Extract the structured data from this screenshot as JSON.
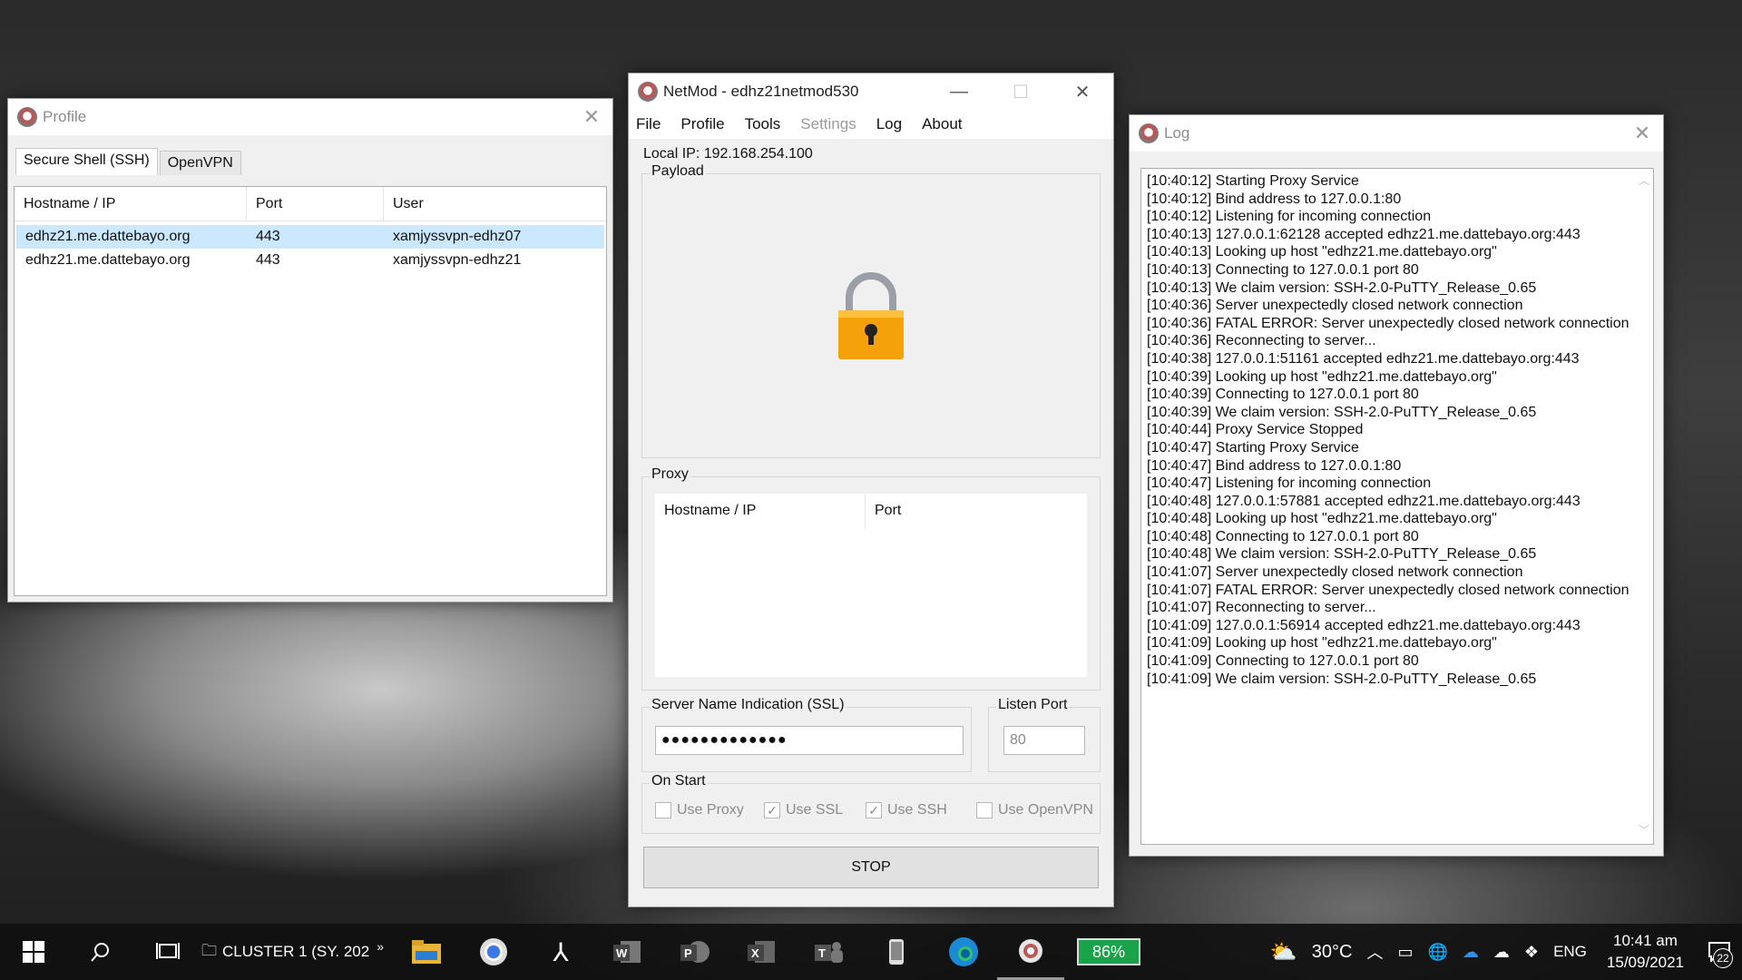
{
  "profile": {
    "title": "Profile",
    "tabs": [
      "Secure Shell (SSH)",
      "OpenVPN"
    ],
    "columns": [
      "Hostname / IP",
      "Port",
      "User"
    ],
    "rows": [
      [
        "edhz21.me.dattebayo.org",
        "443",
        "xamjyssvpn-edhz07"
      ],
      [
        "edhz21.me.dattebayo.org",
        "443",
        "xamjyssvpn-edhz21"
      ]
    ]
  },
  "netmod": {
    "title": "NetMod - edhz21netmod530",
    "menu": [
      "File",
      "Profile",
      "Tools",
      "Settings",
      "Log",
      "About"
    ],
    "local_ip": "Local IP: 192.168.254.100",
    "payload_label": "Payload",
    "proxy_label": "Proxy",
    "proxy_columns": [
      "Hostname / IP",
      "Port"
    ],
    "sni_label": "Server Name Indication (SSL)",
    "sni_value": "●●●●●●●●●●●●●",
    "listen_port_label": "Listen Port",
    "listen_port_value": "80",
    "on_start_label": "On Start",
    "checks": [
      {
        "label": "Use Proxy",
        "checked": false
      },
      {
        "label": "Use SSL",
        "checked": true
      },
      {
        "label": "Use SSH",
        "checked": true
      },
      {
        "label": "Use OpenVPN",
        "checked": false
      }
    ],
    "stop_label": "STOP"
  },
  "log": {
    "title": "Log",
    "lines": [
      "[10:40:12] Starting Proxy Service",
      "[10:40:12] Bind address to 127.0.0.1:80",
      "[10:40:12] Listening for incoming connection",
      "[10:40:13] 127.0.0.1:62128 accepted edhz21.me.dattebayo.org:443",
      "[10:40:13] Looking up host \"edhz21.me.dattebayo.org\"",
      "[10:40:13] Connecting to 127.0.0.1 port 80",
      "[10:40:13] We claim version: SSH-2.0-PuTTY_Release_0.65",
      "[10:40:36] Server unexpectedly closed network connection",
      "[10:40:36] FATAL ERROR: Server unexpectedly closed network connection",
      "[10:40:36] Reconnecting to server...",
      "[10:40:38] 127.0.0.1:51161 accepted edhz21.me.dattebayo.org:443",
      "[10:40:39] Looking up host \"edhz21.me.dattebayo.org\"",
      "[10:40:39] Connecting to 127.0.0.1 port 80",
      "[10:40:39] We claim version: SSH-2.0-PuTTY_Release_0.65",
      "[10:40:44] Proxy Service Stopped",
      "[10:40:47] Starting Proxy Service",
      "[10:40:47] Bind address to 127.0.0.1:80",
      "[10:40:47] Listening for incoming connection",
      "[10:40:48] 127.0.0.1:57881 accepted edhz21.me.dattebayo.org:443",
      "[10:40:48] Looking up host \"edhz21.me.dattebayo.org\"",
      "[10:40:48] Connecting to 127.0.0.1 port 80",
      "[10:40:48] We claim version: SSH-2.0-PuTTY_Release_0.65",
      "[10:41:07] Server unexpectedly closed network connection",
      "[10:41:07] FATAL ERROR: Server unexpectedly closed network connection",
      "[10:41:07] Reconnecting to server...",
      "[10:41:09] 127.0.0.1:56914 accepted edhz21.me.dattebayo.org:443",
      "[10:41:09] Looking up host \"edhz21.me.dattebayo.org\"",
      "[10:41:09] Connecting to 127.0.0.1 port 80",
      "[10:41:09] We claim version: SSH-2.0-PuTTY_Release_0.65"
    ]
  },
  "taskbar": {
    "cluster_label": "CLUSTER 1 (SY. 202",
    "battery": "86%",
    "temperature": "30°C",
    "language": "ENG",
    "time": "10:41 am",
    "date": "15/09/2021",
    "notifications": "22",
    "icons": [
      "windows-icon",
      "search-icon",
      "task-view-icon",
      "file-explorer-icon",
      "chrome-icon",
      "acrobat-icon",
      "word-icon",
      "powerpoint-icon",
      "excel-icon",
      "teams-icon",
      "phone-icon",
      "edge-icon",
      "netmod-icon"
    ]
  }
}
